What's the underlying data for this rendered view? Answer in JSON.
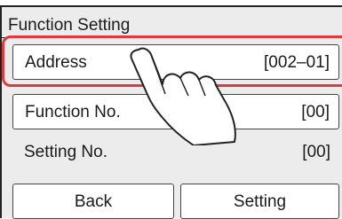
{
  "window": {
    "title": "Function Setting"
  },
  "rows": [
    {
      "label": "Address",
      "value": "[002–01]"
    },
    {
      "label": "Function No.",
      "value": "[00]"
    },
    {
      "label": "Setting No.",
      "value": "[00]"
    }
  ],
  "buttons": {
    "back": "Back",
    "setting": "Setting"
  },
  "colors": {
    "highlight": "#e03a3e",
    "background": "#ececec"
  },
  "icons": {
    "pointer": "hand-pointer-icon"
  }
}
